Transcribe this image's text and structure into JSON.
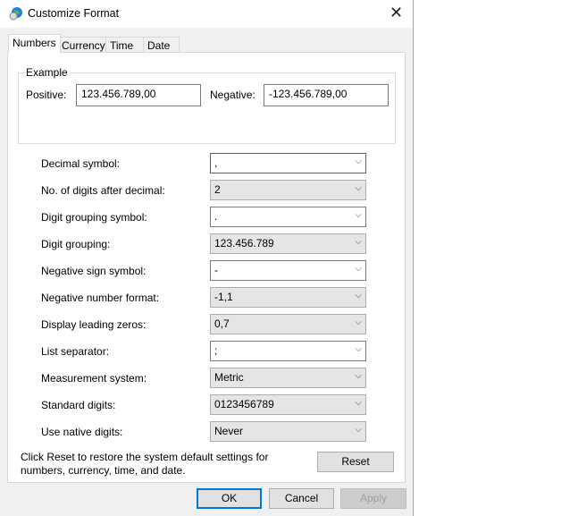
{
  "window": {
    "title": "Customize Format",
    "icon": "globe-clock-icon"
  },
  "tabs": [
    {
      "label": "Numbers",
      "active": true
    },
    {
      "label": "Currency"
    },
    {
      "label": "Time"
    },
    {
      "label": "Date"
    }
  ],
  "example": {
    "label": "Example",
    "positive_label": "Positive:",
    "positive_value": "123.456.789,00",
    "negative_label": "Negative:",
    "negative_value": "-123.456.789,00"
  },
  "settings": [
    {
      "label": "Decimal symbol:",
      "value": ",",
      "editable": true
    },
    {
      "label": "No. of digits after decimal:",
      "value": "2",
      "editable": false
    },
    {
      "label": "Digit grouping symbol:",
      "value": ".",
      "editable": true
    },
    {
      "label": "Digit grouping:",
      "value": "123.456.789",
      "editable": false
    },
    {
      "label": "Negative sign symbol:",
      "value": "-",
      "editable": true
    },
    {
      "label": "Negative number format:",
      "value": "-1,1",
      "editable": false
    },
    {
      "label": "Display leading zeros:",
      "value": "0,7",
      "editable": false
    },
    {
      "label": "List separator:",
      "value": ";",
      "editable": true
    },
    {
      "label": "Measurement system:",
      "value": "Metric",
      "editable": false
    },
    {
      "label": "Standard digits:",
      "value": "0123456789",
      "editable": false
    },
    {
      "label": "Use native digits:",
      "value": "Never",
      "editable": false
    }
  ],
  "reset": {
    "text": "Click Reset to restore the system default settings for numbers, currency, time, and date.",
    "button": "Reset"
  },
  "buttons": {
    "ok": "OK",
    "cancel": "Cancel",
    "apply": "Apply"
  }
}
